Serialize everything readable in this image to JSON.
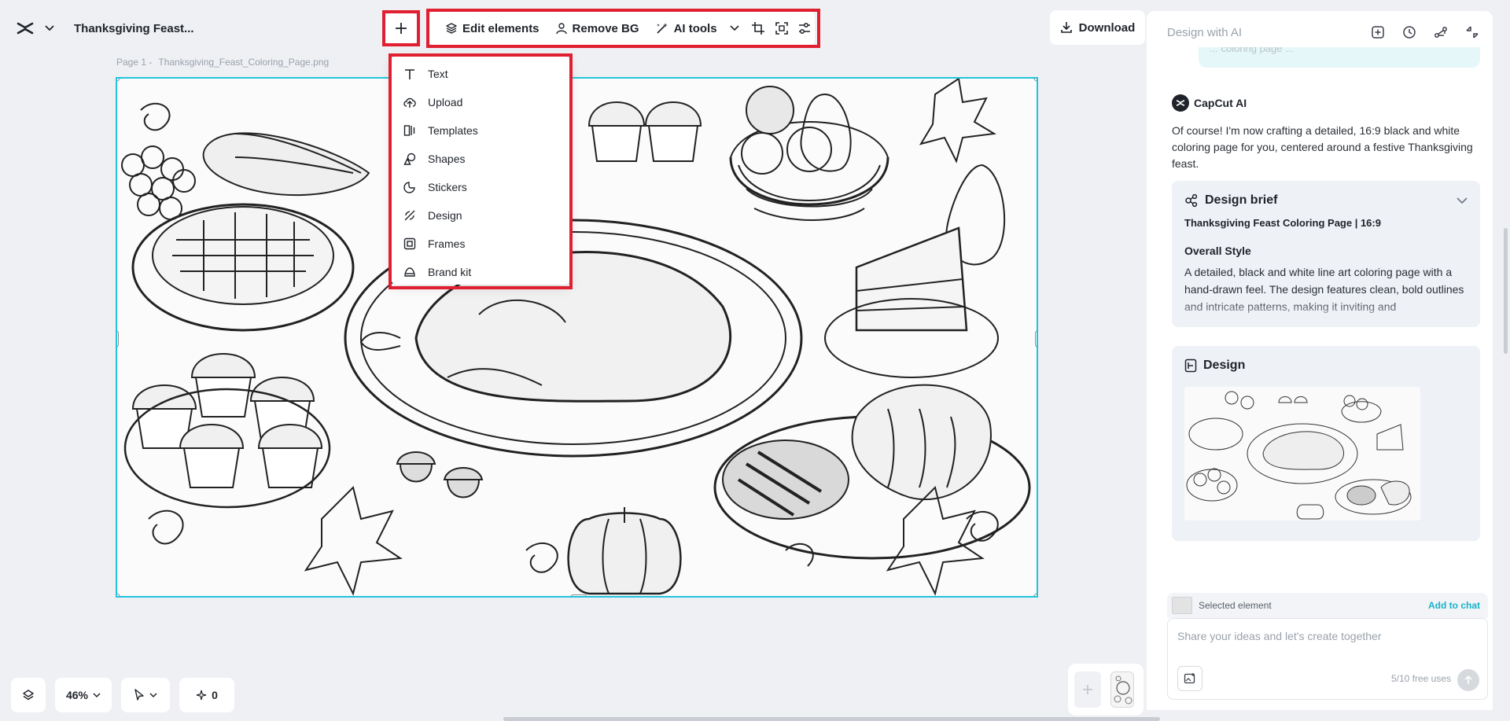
{
  "app": {
    "doc_title": "Thanksgiving Feast...",
    "add_button_label": "+"
  },
  "toolbar": {
    "edit_elements": "Edit elements",
    "remove_bg": "Remove BG",
    "ai_tools": "AI tools"
  },
  "download": {
    "label": "Download"
  },
  "breadcrumb": {
    "page": "Page 1 -",
    "file": "Thanksgiving_Feast_Coloring_Page.png"
  },
  "dropdown": {
    "items": [
      {
        "label": "Text",
        "icon": "text-icon"
      },
      {
        "label": "Upload",
        "icon": "upload-cloud-icon"
      },
      {
        "label": "Templates",
        "icon": "templates-icon"
      },
      {
        "label": "Shapes",
        "icon": "shapes-icon"
      },
      {
        "label": "Stickers",
        "icon": "stickers-icon"
      },
      {
        "label": "Design",
        "icon": "design-icon"
      },
      {
        "label": "Frames",
        "icon": "frames-icon"
      },
      {
        "label": "Brand kit",
        "icon": "brand-kit-icon"
      }
    ]
  },
  "bottom": {
    "zoom": "46%",
    "ai_count": "0"
  },
  "panel": {
    "title": "Design with AI",
    "user_bubble_text": "... coloring page ...",
    "ai_name": "CapCut AI",
    "ai_message": "Of course! I'm now crafting a detailed, 16:9 black and white coloring page for you, centered around a festive Thanksgiving feast.",
    "brief": {
      "title": "Design brief",
      "subtitle": "Thanksgiving Feast Coloring Page | 16:9",
      "section": "Overall Style",
      "text": "A detailed, black and white line art coloring page with a hand-drawn feel. The design features clean, bold outlines and intricate patterns, making it inviting and"
    },
    "design": {
      "title": "Design"
    },
    "selected_element": "Selected element",
    "add_to_chat": "Add to chat",
    "input_placeholder": "Share your ideas and let's create together",
    "free_uses": "5/10 free uses"
  },
  "colors": {
    "accent": "#22c4dc",
    "highlight_box": "#e02030",
    "link": "#17b3c9",
    "background": "#eef0f4"
  }
}
